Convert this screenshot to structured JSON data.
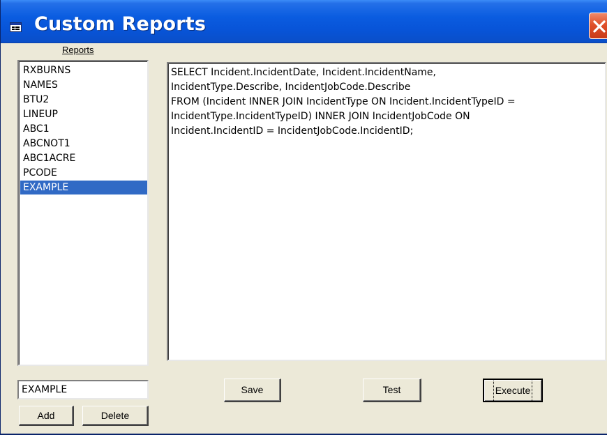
{
  "window": {
    "title": "Custom Reports",
    "titlebar_color": "#0a5ce0",
    "close_icon": "close-x-icon"
  },
  "reports": {
    "label": "Reports",
    "items": [
      {
        "label": "RXBURNS"
      },
      {
        "label": "NAMES"
      },
      {
        "label": "BTU2"
      },
      {
        "label": "LINEUP"
      },
      {
        "label": "ABC1"
      },
      {
        "label": "ABCNOT1"
      },
      {
        "label": "ABC1ACRE"
      },
      {
        "label": "PCODE"
      },
      {
        "label": "EXAMPLE",
        "selected": true
      }
    ],
    "selection_color": "#316ac5"
  },
  "sql": {
    "lines": [
      "SELECT Incident.IncidentDate, Incident.IncidentName,",
      "IncidentType.Describe, IncidentJobCode.Describe",
      "FROM (Incident INNER JOIN IncidentType ON Incident.IncidentTypeID =",
      "IncidentType.IncidentTypeID) INNER JOIN IncidentJobCode ON",
      "Incident.IncidentID = IncidentJobCode.IncidentID;"
    ]
  },
  "name_field": {
    "value": "EXAMPLE"
  },
  "buttons": {
    "add": "Add",
    "delete": "Delete",
    "save": "Save",
    "test": "Test",
    "execute": "Execute"
  }
}
